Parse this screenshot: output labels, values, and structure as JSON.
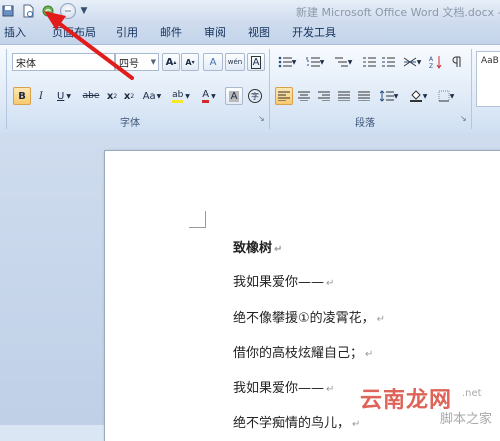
{
  "window": {
    "title": "新建 Microsoft Office Word 文档.docx -"
  },
  "quick_access": {
    "dropdown_glyph": "▼"
  },
  "tabs": [
    {
      "label": "插入"
    },
    {
      "label": "页面布局"
    },
    {
      "label": "引用"
    },
    {
      "label": "邮件"
    },
    {
      "label": "审阅"
    },
    {
      "label": "视图"
    },
    {
      "label": "开发工具"
    }
  ],
  "font_group": {
    "label": "字体",
    "font_name": "宋体",
    "font_size": "四号",
    "grow_label": "A",
    "shrink_label": "A",
    "clear_format_label": "A",
    "phonetic_label": "wén",
    "border_char_label": "A",
    "bold": "B",
    "italic": "I",
    "underline": "U",
    "strikethrough": "abe",
    "subscript": "x",
    "superscript": "x",
    "change_case": "Aa",
    "highlight": "ab",
    "font_color": "A",
    "shading_char": "A",
    "enclose_char": "字"
  },
  "paragraph_group": {
    "label": "段落"
  },
  "styles_group": {
    "preview": "AaB"
  },
  "document": {
    "lines": [
      {
        "text": "致橡树",
        "mark": "↵"
      },
      {
        "text": "我如果爱你——",
        "mark": "↵"
      },
      {
        "text": "绝不像攀援①的凌霄花，",
        "mark": "↵"
      },
      {
        "text": "借你的高枝炫耀自己；",
        "mark": "↵"
      },
      {
        "text": "我如果爱你——",
        "mark": "↵"
      },
      {
        "text": "绝不学痴情的鸟儿，",
        "mark": "↵"
      }
    ]
  },
  "watermark": {
    "main": "云南龙网",
    "sub": "脚本之家",
    "net": ".net"
  },
  "colors": {
    "highlight": "#f5e829",
    "font_color": "#d22b2b",
    "arrow": "#e21b1b"
  }
}
